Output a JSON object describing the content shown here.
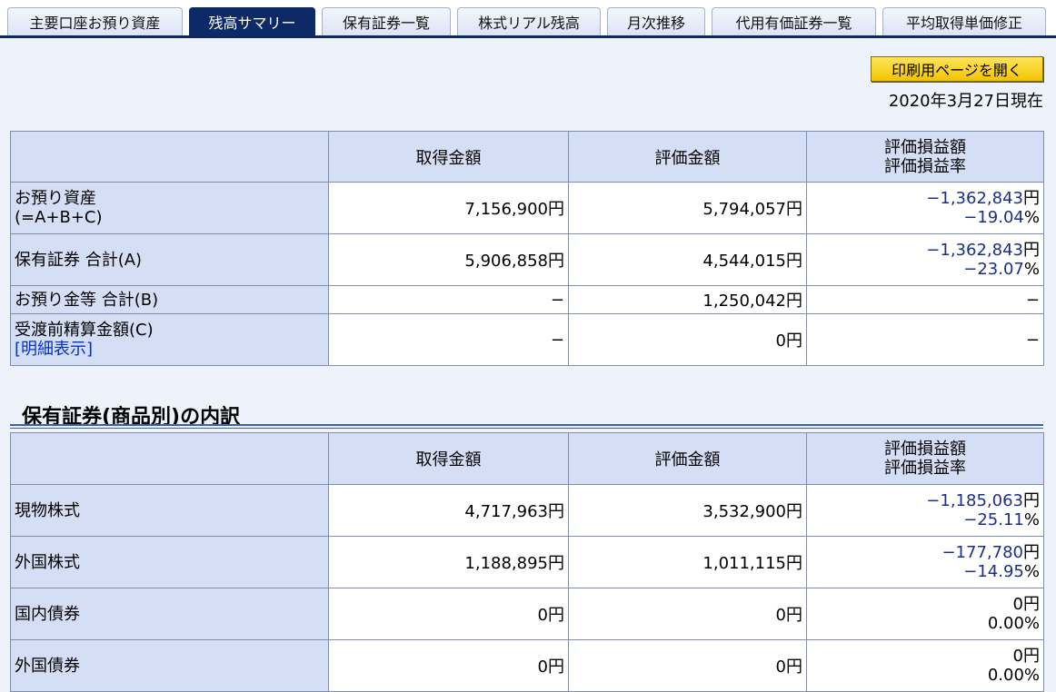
{
  "tabs": [
    {
      "label": "主要口座お預り資産",
      "active": false
    },
    {
      "label": "残高サマリー",
      "active": true
    },
    {
      "label": "保有証券一覧",
      "active": false
    },
    {
      "label": "株式リアル残高",
      "active": false
    },
    {
      "label": "月次推移",
      "active": false
    },
    {
      "label": "代用有価証券一覧",
      "active": false
    },
    {
      "label": "平均取得単価修正",
      "active": false
    }
  ],
  "print_button": "印刷用ページを開く",
  "as_of_date": "2020年3月27日現在",
  "summary": {
    "headers": {
      "acquisition": "取得金額",
      "valuation": "評価金額",
      "pl_amount": "評価損益額",
      "pl_rate": "評価損益率"
    },
    "rows": [
      {
        "label1": "お預り資産",
        "label2": "(=A+B+C)",
        "acquisition": "7,156,900円",
        "valuation": "5,794,057円",
        "pl_amount": "−1,362,843",
        "pl_unit": "円",
        "pl_rate": "−19.04",
        "pl_rate_unit": "%"
      },
      {
        "label1": "保有証券 合計(A)",
        "acquisition": "5,906,858円",
        "valuation": "4,544,015円",
        "pl_amount": "−1,362,843",
        "pl_unit": "円",
        "pl_rate": "−23.07",
        "pl_rate_unit": "%"
      },
      {
        "label1": "お預り金等 合計(B)",
        "acquisition": "−",
        "valuation": "1,250,042円",
        "pl_single": "−"
      },
      {
        "label1": "受渡前精算金額(C)",
        "link": "[明細表示]",
        "acquisition": "−",
        "valuation": "0円",
        "pl_single": "−"
      }
    ]
  },
  "section_title": "保有証券(商品別)の内訳",
  "breakdown": {
    "headers": {
      "acquisition": "取得金額",
      "valuation": "評価金額",
      "pl_amount": "評価損益額",
      "pl_rate": "評価損益率"
    },
    "rows": [
      {
        "label": "現物株式",
        "acquisition": "4,717,963円",
        "valuation": "3,532,900円",
        "pl_amount": "−1,185,063",
        "pl_unit": "円",
        "pl_rate": "−25.11",
        "pl_rate_unit": "%"
      },
      {
        "label": "外国株式",
        "acquisition": "1,188,895円",
        "valuation": "1,011,115円",
        "pl_amount": "−177,780",
        "pl_unit": "円",
        "pl_rate": "−14.95",
        "pl_rate_unit": "%"
      },
      {
        "label": "国内債券",
        "acquisition": "0円",
        "valuation": "0円",
        "pl_amount": "0円",
        "pl_rate": "0.00%"
      },
      {
        "label": "外国債券",
        "acquisition": "0円",
        "valuation": "0円",
        "pl_amount": "0円",
        "pl_rate": "0.00%"
      }
    ]
  }
}
